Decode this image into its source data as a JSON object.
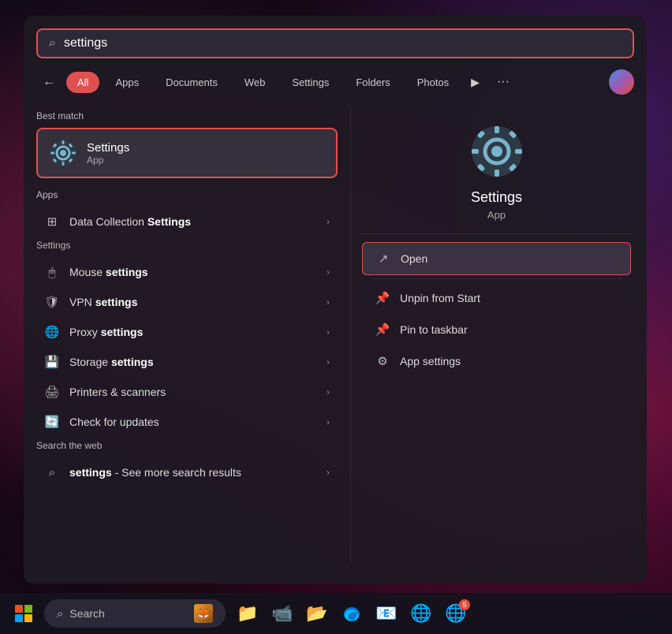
{
  "wallpaper": {
    "alt": "purple-red gradient wallpaper"
  },
  "search_bar": {
    "value": "settings",
    "placeholder": "Search",
    "search_icon": "🔍"
  },
  "filter_tabs": {
    "back_label": "←",
    "items": [
      {
        "id": "all",
        "label": "All",
        "active": true
      },
      {
        "id": "apps",
        "label": "Apps",
        "active": false
      },
      {
        "id": "documents",
        "label": "Documents",
        "active": false
      },
      {
        "id": "web",
        "label": "Web",
        "active": false
      },
      {
        "id": "settings",
        "label": "Settings",
        "active": false
      },
      {
        "id": "folders",
        "label": "Folders",
        "active": false
      },
      {
        "id": "photos",
        "label": "Photos",
        "active": false
      }
    ],
    "play_label": "▶",
    "more_label": "···"
  },
  "best_match": {
    "section_title": "Best match",
    "item": {
      "name": "Settings",
      "type": "App"
    }
  },
  "apps_section": {
    "section_title": "Apps",
    "items": [
      {
        "icon": "⊞",
        "text_plain": "Data Collection ",
        "text_bold": "Settings",
        "has_arrow": true
      }
    ]
  },
  "settings_section": {
    "section_title": "Settings",
    "items": [
      {
        "icon": "🖱️",
        "text_plain": "Mouse ",
        "text_bold": "settings",
        "has_arrow": true
      },
      {
        "icon": "🛡️",
        "text_plain": "VPN ",
        "text_bold": "settings",
        "has_arrow": true
      },
      {
        "icon": "🌐",
        "text_plain": "Proxy ",
        "text_bold": "settings",
        "has_arrow": true
      },
      {
        "icon": "💾",
        "text_plain": "Storage ",
        "text_bold": "settings",
        "has_arrow": true
      },
      {
        "icon": "🖨️",
        "text_plain": "Printers & scanners",
        "text_bold": "",
        "has_arrow": true
      },
      {
        "icon": "🔄",
        "text_plain": "Check for updates",
        "text_bold": "",
        "has_arrow": true
      }
    ]
  },
  "search_web_section": {
    "section_title": "Search the web",
    "items": [
      {
        "icon": "🔍",
        "text_plain": "settings",
        "text_suffix": " - See more search results",
        "has_arrow": true
      }
    ]
  },
  "right_panel": {
    "app_name": "Settings",
    "app_type": "App",
    "actions": [
      {
        "id": "open",
        "icon": "↗",
        "label": "Open",
        "highlighted": true
      },
      {
        "id": "unpin",
        "icon": "📌",
        "label": "Unpin from Start",
        "highlighted": false
      },
      {
        "id": "pin-taskbar",
        "icon": "📌",
        "label": "Pin to taskbar",
        "highlighted": false
      },
      {
        "id": "app-settings",
        "icon": "⚙",
        "label": "App settings",
        "highlighted": false
      }
    ]
  },
  "taskbar": {
    "search_label": "Search",
    "apps": [
      {
        "id": "file-explorer",
        "icon": "📁",
        "color": "#f0a030"
      },
      {
        "id": "teams",
        "icon": "📹",
        "color": "#5b5fc7"
      },
      {
        "id": "file-manager",
        "icon": "📂",
        "color": "#f0a030"
      },
      {
        "id": "edge",
        "icon": "edge",
        "color": "#0078d4"
      },
      {
        "id": "outlook",
        "icon": "📧",
        "color": "#0078d4"
      },
      {
        "id": "chrome",
        "icon": "🌐",
        "color": "#4285f4"
      },
      {
        "id": "chrome-badge",
        "icon": "🌐",
        "color": "#e74c3c",
        "badge": "5"
      }
    ]
  }
}
